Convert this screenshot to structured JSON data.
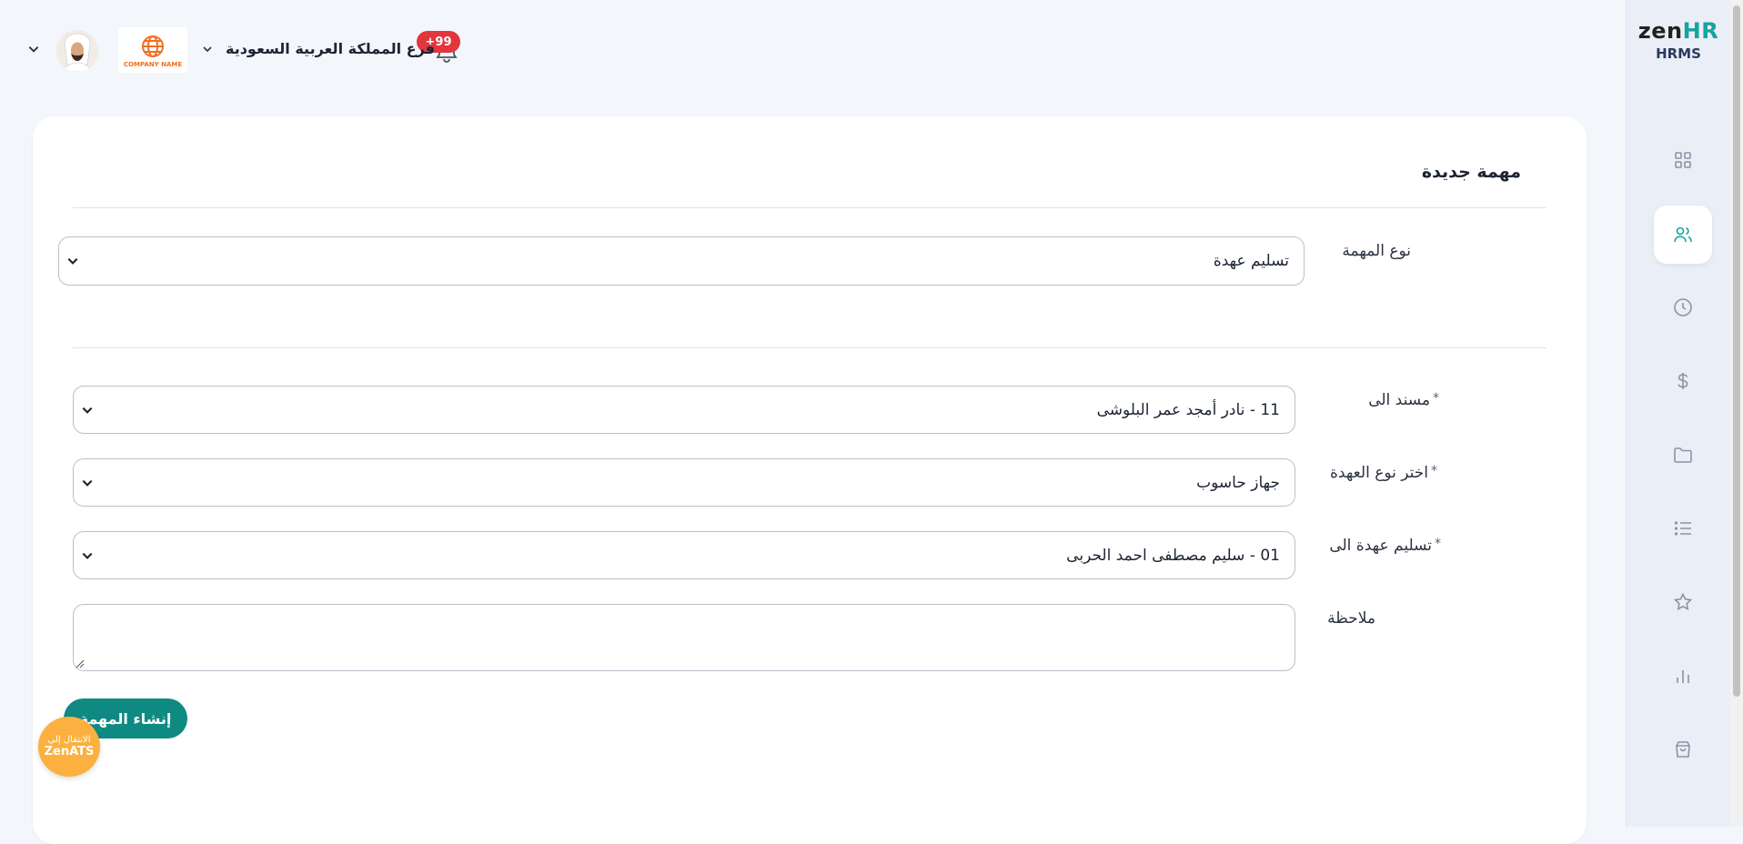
{
  "brand": {
    "logo_main": "zen",
    "logo_accent": "HR",
    "subtitle": "HRMS"
  },
  "header": {
    "notification_count": "+99",
    "branch": "فرع المملكة العربية السعودية",
    "company_logo_text": "COMPANY NAME"
  },
  "sidebar": {
    "items": [
      {
        "icon": "dashboard-grid-icon"
      },
      {
        "icon": "users-icon",
        "active": true
      },
      {
        "icon": "clock-icon"
      },
      {
        "icon": "dollar-icon"
      },
      {
        "icon": "folder-icon"
      },
      {
        "icon": "list-icon"
      },
      {
        "icon": "star-icon"
      },
      {
        "icon": "bar-chart-icon"
      },
      {
        "icon": "shopping-bag-icon"
      }
    ]
  },
  "form": {
    "title": "مهمة جديدة",
    "task_type": {
      "label": "نوع المهمة",
      "value": "تسليم عهدة"
    },
    "assigned_to": {
      "label": "مسند الى",
      "required": "*",
      "value": "11 - نادر أمجد عمر البلوشى"
    },
    "custody_type": {
      "label": "اختر نوع العهدة",
      "required": "*",
      "value": "جهاز حاسوب"
    },
    "deliver_to": {
      "label": "تسليم عهدة الى",
      "required": "*",
      "value": "01 - سليم مصطفى احمد الحربى"
    },
    "note": {
      "label": "ملاحظة",
      "value": ""
    },
    "submit_label": "إنشاء المهمة"
  },
  "ats_button": {
    "line1": "الانتقال إلى",
    "line2": "ZenATS"
  },
  "colors": {
    "accent": "#0f8a83",
    "badge": "#e2353d",
    "ats": "#fbb040"
  }
}
